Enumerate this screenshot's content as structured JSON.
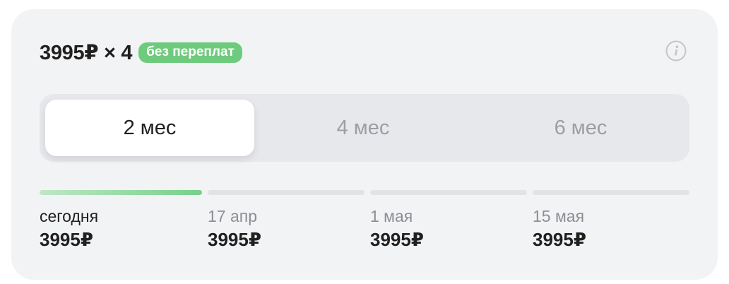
{
  "header": {
    "price_line": "3995₽ × 4",
    "badge": "без переплат"
  },
  "icons": {
    "info": "info-circle-icon"
  },
  "periods": {
    "options": [
      "2 мес",
      "4 мес",
      "6 мес"
    ],
    "selected": "2 мес"
  },
  "schedule": [
    {
      "date": "сегодня",
      "amount": "3995₽",
      "paid": true
    },
    {
      "date": "17 апр",
      "amount": "3995₽",
      "paid": false
    },
    {
      "date": "1 мая",
      "amount": "3995₽",
      "paid": false
    },
    {
      "date": "15 мая",
      "amount": "3995₽",
      "paid": false
    }
  ],
  "colors": {
    "accent_green": "#6ecb7d",
    "text_primary": "#21201f",
    "text_muted": "#8d8e93",
    "card_bg": "#f2f3f5"
  }
}
